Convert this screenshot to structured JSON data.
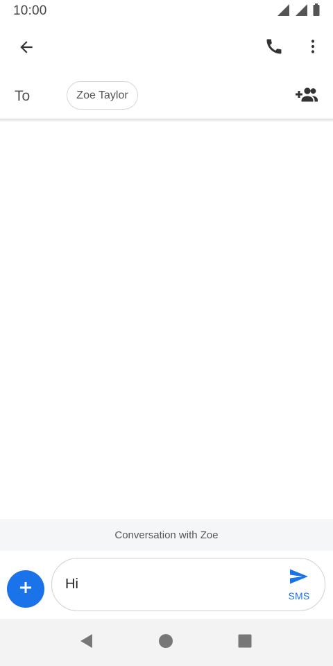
{
  "status_bar": {
    "time": "10:00",
    "icons": [
      "signal-icon",
      "signal-icon",
      "battery-icon"
    ]
  },
  "toolbar": {
    "back_icon": "arrow-back-icon",
    "call_icon": "phone-icon",
    "more_icon": "more-vert-icon"
  },
  "recipients": {
    "to_label": "To",
    "chips": [
      {
        "name": "Zoe Taylor"
      }
    ],
    "add_icon": "add-people-icon"
  },
  "conversation": {
    "banner": "Conversation with Zoe"
  },
  "compose": {
    "attach_icon": "plus-icon",
    "message_value": "Hi",
    "send_icon": "send-icon",
    "send_label": "SMS"
  },
  "nav_bar": {
    "buttons": [
      "nav-back-icon",
      "nav-home-icon",
      "nav-recents-icon"
    ]
  },
  "colors": {
    "accent": "#1a73e8",
    "icon": "#333333",
    "nav_icon": "#777777",
    "banner_bg": "#f5f6f7"
  }
}
